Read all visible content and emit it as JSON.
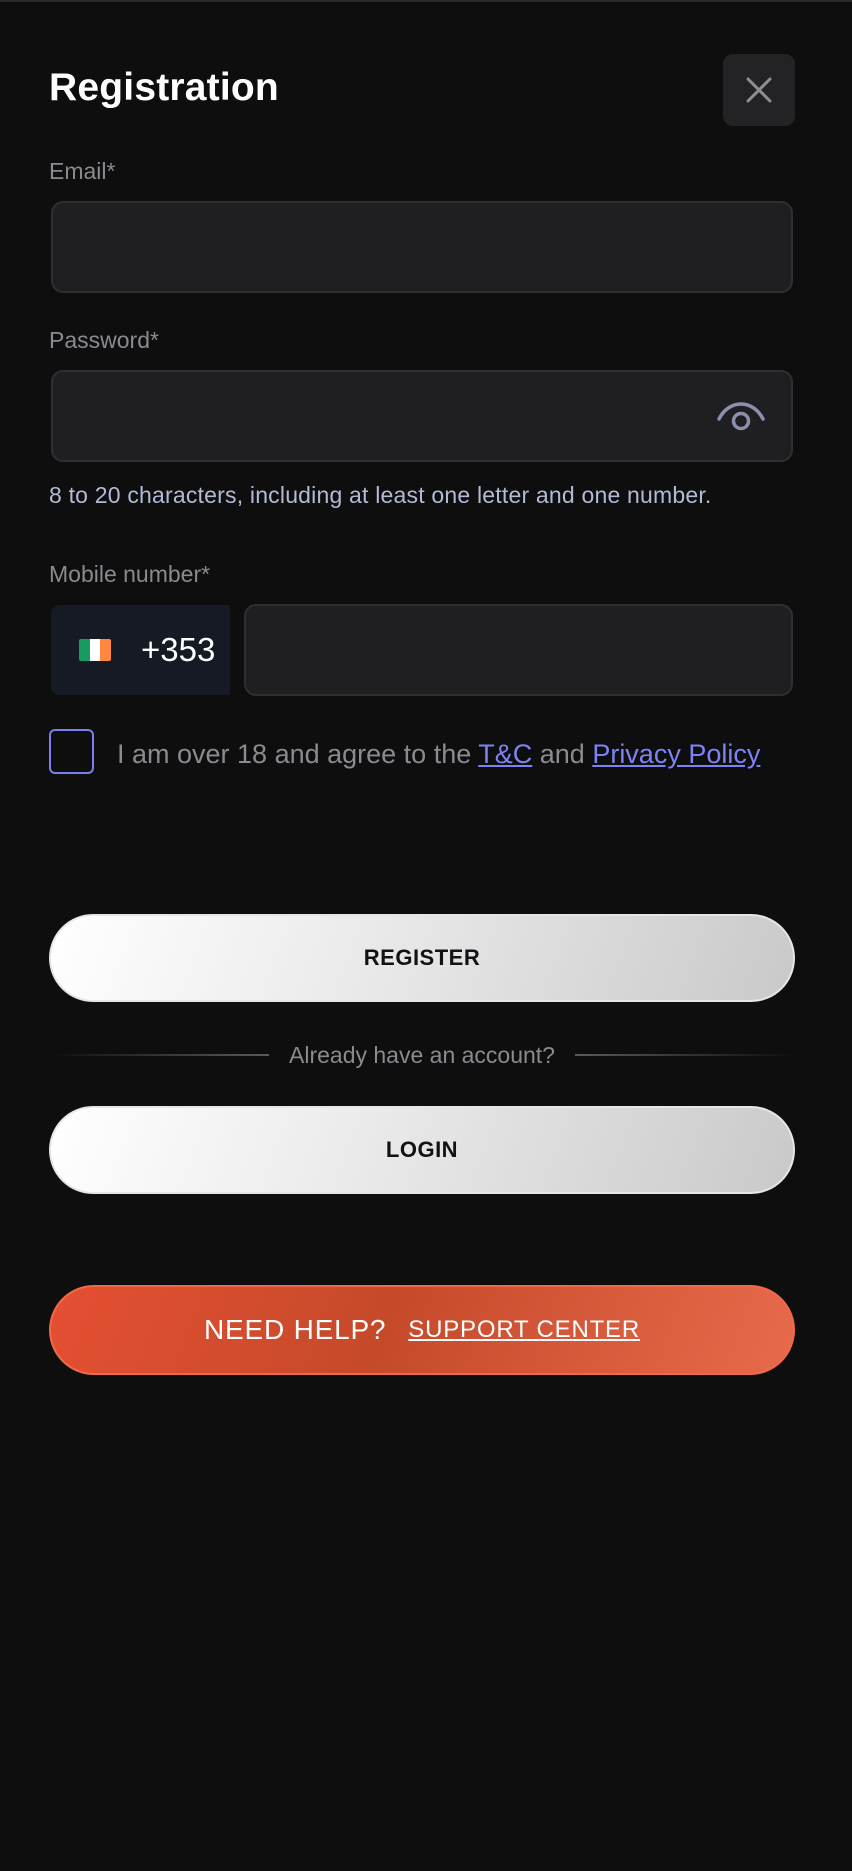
{
  "dialog": {
    "title": "Registration"
  },
  "email": {
    "label": "Email*",
    "value": "",
    "placeholder": ""
  },
  "password": {
    "label": "Password*",
    "value": "",
    "placeholder": "",
    "hint": "8 to 20 characters, including at least one letter and one number."
  },
  "mobile": {
    "label": "Mobile number*",
    "country_flag": "ireland-flag",
    "dial_code": "+353",
    "value": "",
    "placeholder": ""
  },
  "agreement": {
    "checked": false,
    "text_before": "I am over 18 and agree to the ",
    "tc_link": "T&C",
    "text_middle": " and ",
    "privacy_link": "Privacy Policy"
  },
  "actions": {
    "register_label": "REGISTER",
    "divider_text": "Already have an account?",
    "login_label": "LOGIN"
  },
  "help": {
    "label": "NEED HELP?",
    "link": "SUPPORT CENTER"
  },
  "colors": {
    "background": "#0e0e0f",
    "accent_link": "#7f82f5",
    "help_button": "#e54f32",
    "input_bg": "#1f1f21"
  },
  "icons": {
    "close": "close-icon",
    "eye": "eye-icon",
    "flag": "ireland-flag-icon"
  }
}
